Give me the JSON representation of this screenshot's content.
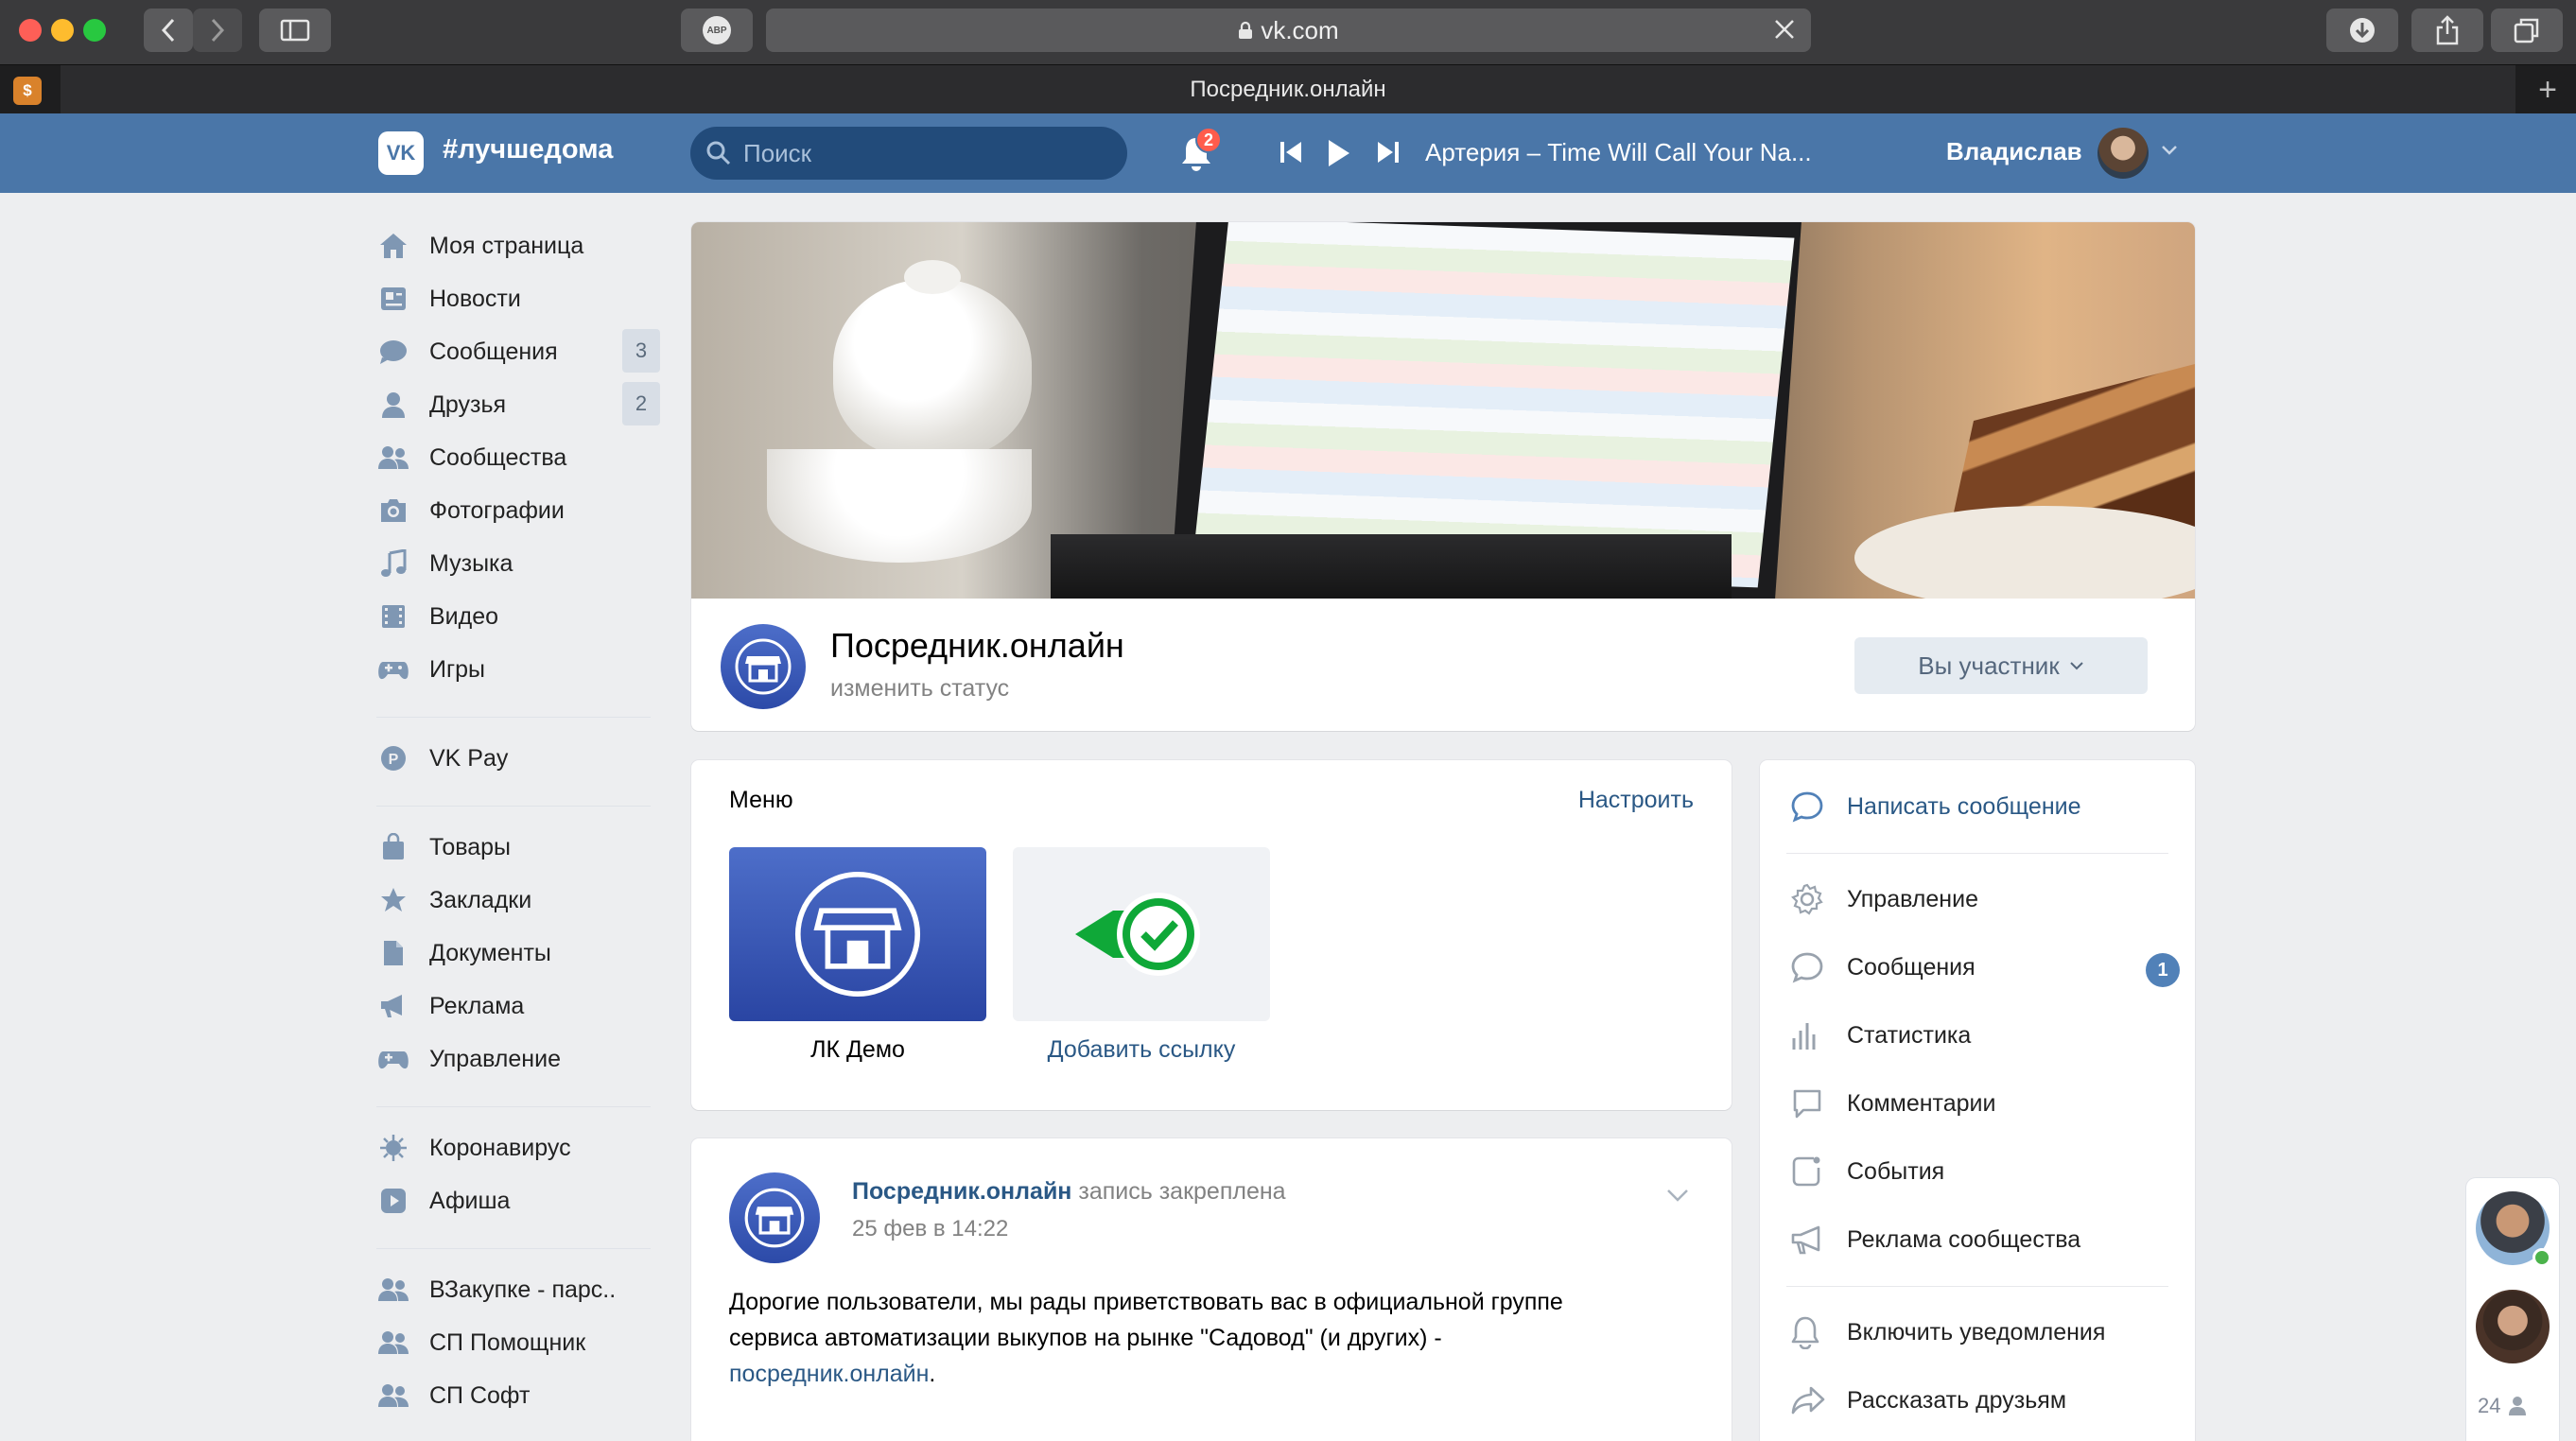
{
  "browser": {
    "address": "vk.com",
    "tab_title": "Посредник.онлайн",
    "abp_label": "ABP"
  },
  "header": {
    "hashtag": "#лучшедома",
    "search_placeholder": "Поиск",
    "notifications_count": "2",
    "now_playing": "Артерия – Time Will Call Your Na...",
    "user_name": "Владислав"
  },
  "sidebar": {
    "items": [
      {
        "label": "Моя страница",
        "icon": "home-icon"
      },
      {
        "label": "Новости",
        "icon": "news-icon"
      },
      {
        "label": "Сообщения",
        "icon": "messages-icon",
        "count": "3"
      },
      {
        "label": "Друзья",
        "icon": "friends-icon",
        "count": "2"
      },
      {
        "label": "Сообщества",
        "icon": "communities-icon"
      },
      {
        "label": "Фотографии",
        "icon": "photo-icon"
      },
      {
        "label": "Музыка",
        "icon": "music-icon"
      },
      {
        "label": "Видео",
        "icon": "video-icon"
      },
      {
        "label": "Игры",
        "icon": "games-icon"
      },
      {
        "label": "VK Pay",
        "icon": "vkpay-icon"
      },
      {
        "label": "Товары",
        "icon": "goods-icon"
      },
      {
        "label": "Закладки",
        "icon": "bookmarks-icon"
      },
      {
        "label": "Документы",
        "icon": "documents-icon"
      },
      {
        "label": "Реклама",
        "icon": "ads-icon"
      },
      {
        "label": "Управление",
        "icon": "manage-icon"
      },
      {
        "label": "Коронавирус",
        "icon": "coronavirus-icon"
      },
      {
        "label": "Афиша",
        "icon": "events-icon"
      },
      {
        "label": "ВЗакупке - парс..",
        "icon": "community-app-icon"
      },
      {
        "label": "СП Помощник",
        "icon": "community-app-icon"
      },
      {
        "label": "СП Софт",
        "icon": "community-app-icon"
      }
    ]
  },
  "group": {
    "name": "Посредник.онлайн",
    "status": "изменить статус",
    "member_button": "Вы участник"
  },
  "menu": {
    "title": "Меню",
    "configure": "Настроить",
    "items": [
      {
        "label": "ЛК Демо"
      },
      {
        "label": "Добавить ссылку"
      }
    ]
  },
  "post": {
    "author": "Посредник.онлайн",
    "action": "запись закреплена",
    "date": "25 фев в 14:22",
    "text_1": "Дорогие пользователи, мы рады приветствовать вас в официальной группе",
    "text_2": "сервиса автоматизации выкупов на рынке \"Садовод\" (и других) -",
    "link": "посредник.онлайн",
    "link_tail": "."
  },
  "actions": {
    "write_message": "Написать сообщение",
    "items": [
      {
        "label": "Управление",
        "icon": "gear-icon"
      },
      {
        "label": "Сообщения",
        "icon": "chat-icon",
        "count": "1"
      },
      {
        "label": "Статистика",
        "icon": "stats-icon"
      },
      {
        "label": "Комментарии",
        "icon": "comments-icon"
      },
      {
        "label": "События",
        "icon": "events-icon"
      },
      {
        "label": "Реклама сообщества",
        "icon": "megaphone-icon"
      }
    ],
    "bottom": [
      {
        "label": "Включить уведомления",
        "icon": "bell-icon"
      },
      {
        "label": "Рассказать друзьям",
        "icon": "share-icon"
      }
    ]
  },
  "chats": {
    "online_count": "24"
  },
  "colors": {
    "vk_blue": "#4a76a8",
    "link": "#2a5885",
    "bg": "#edeef0"
  }
}
